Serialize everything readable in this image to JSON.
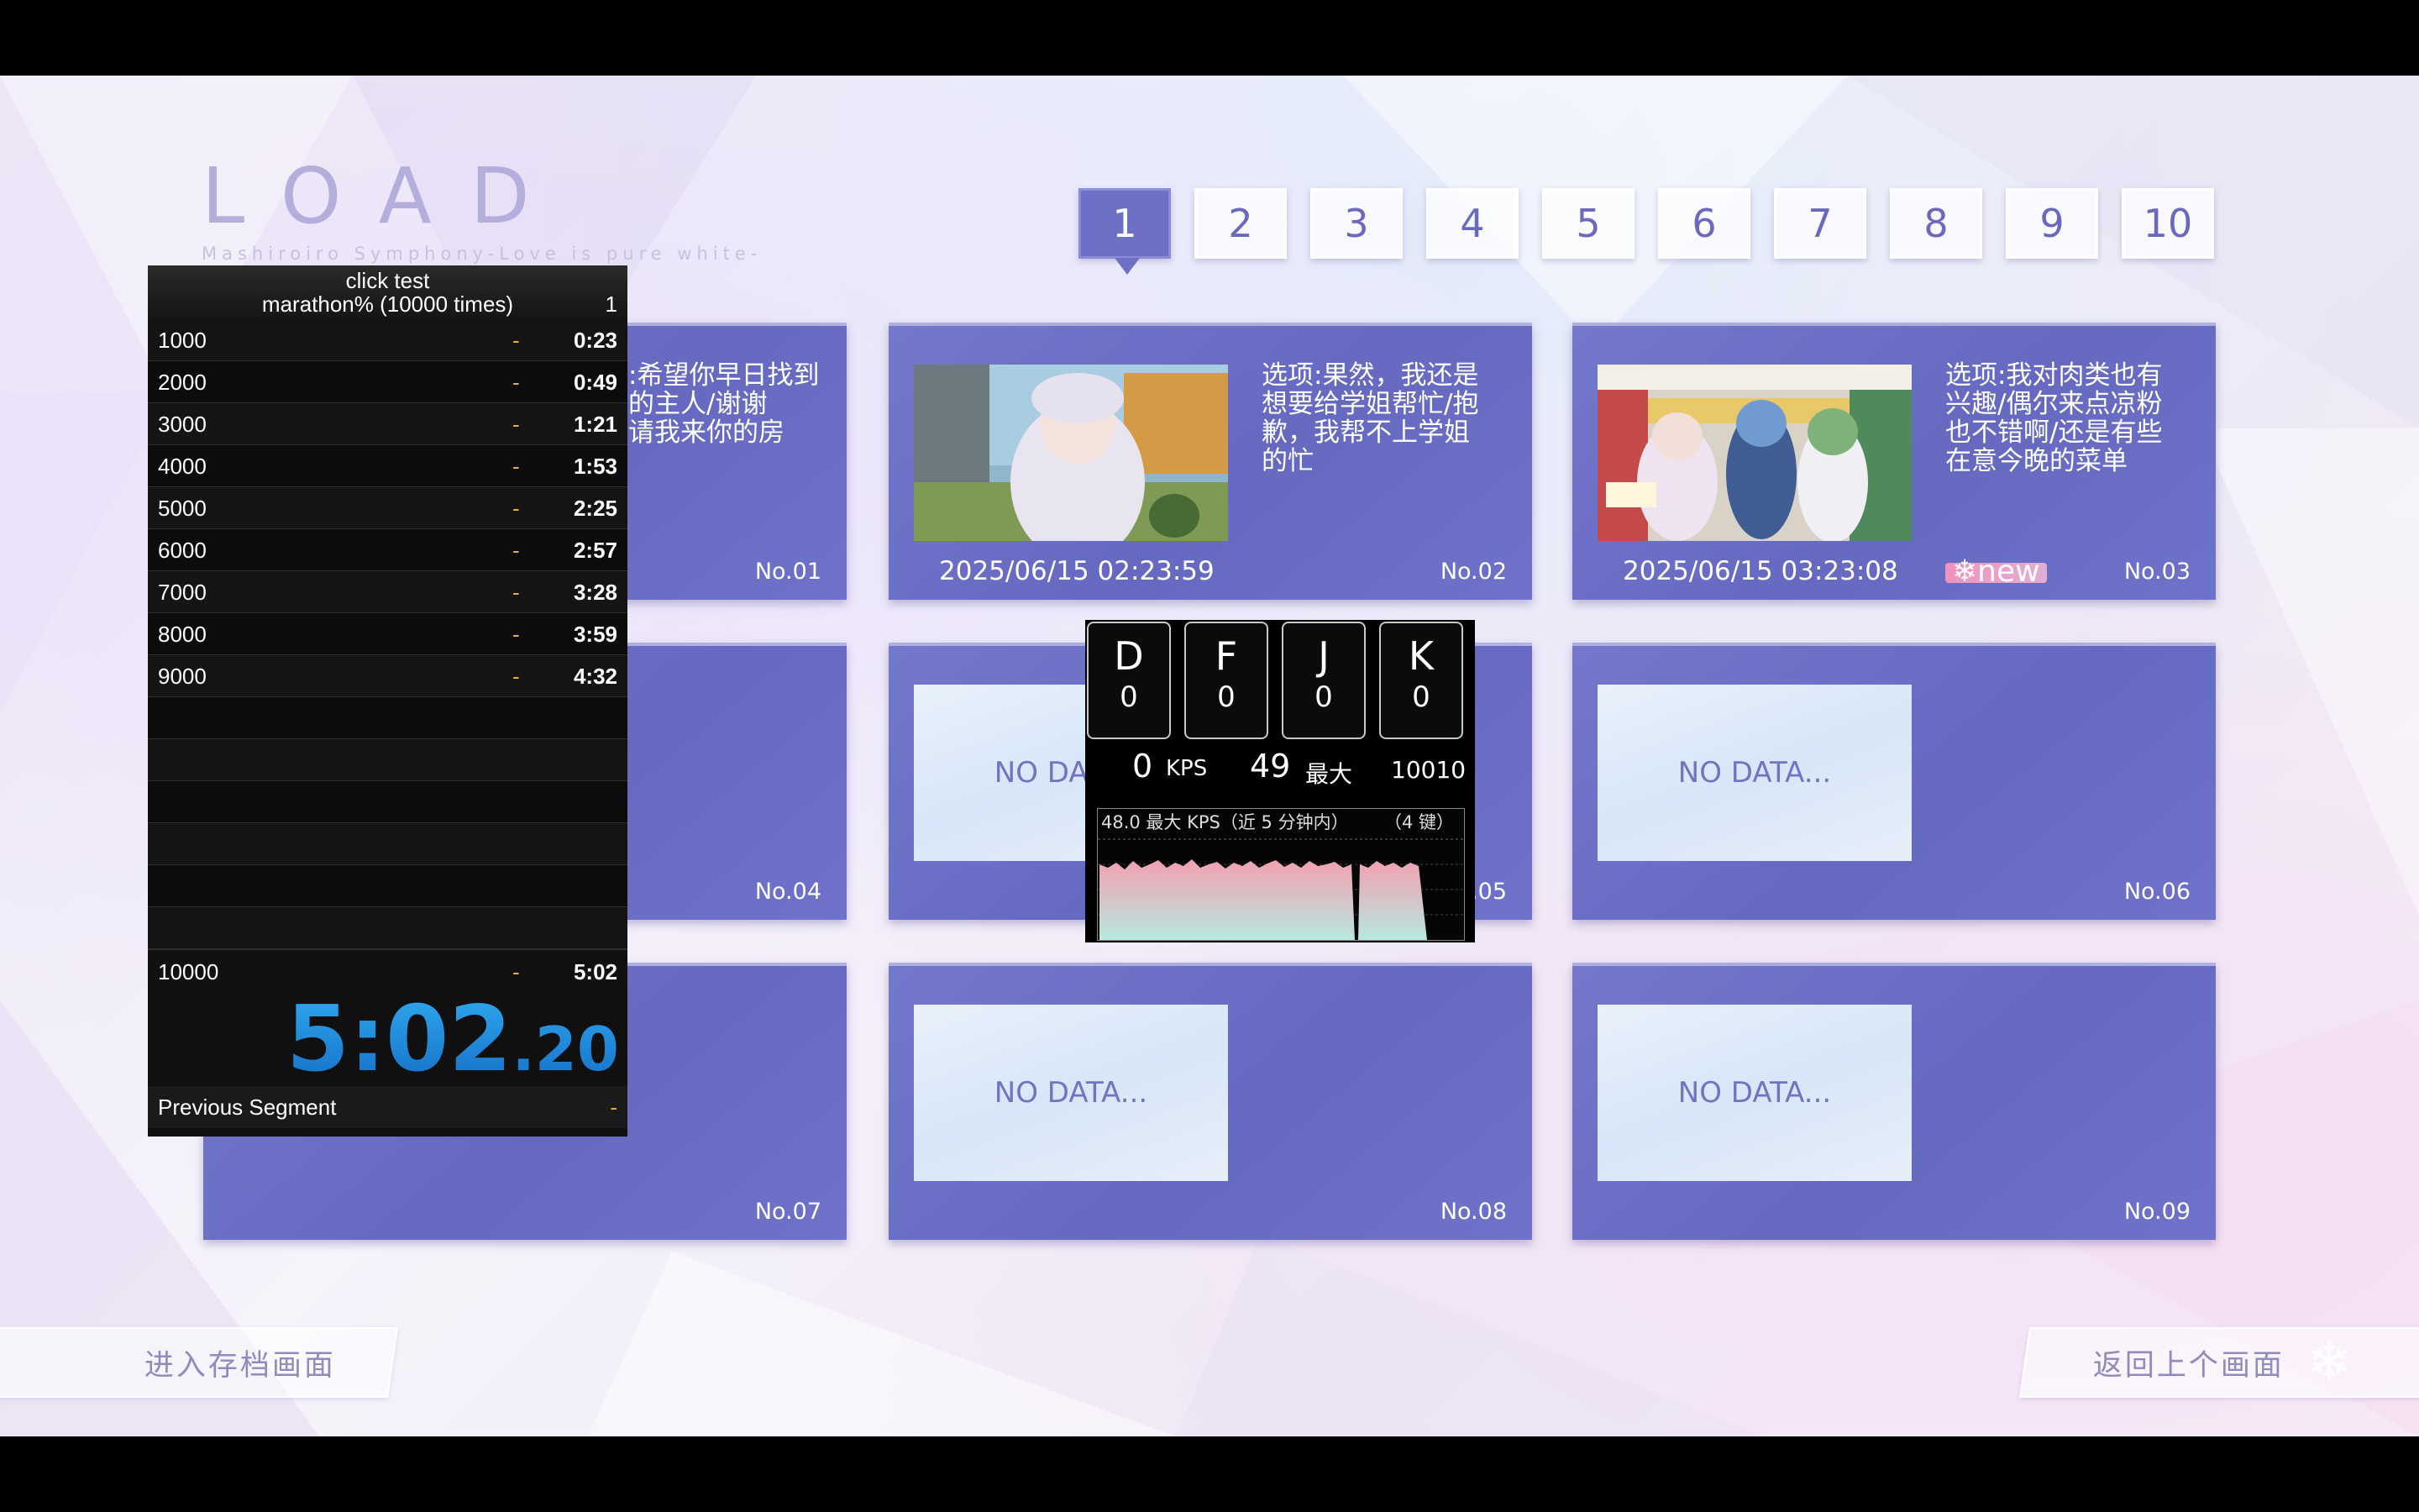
{
  "header": {
    "title": "LOAD",
    "subtitle": "Mashiroiro Symphony-Love is pure white-"
  },
  "pages": {
    "tabs": [
      "1",
      "2",
      "3",
      "4",
      "5",
      "6",
      "7",
      "8",
      "9",
      "10"
    ],
    "active": "1"
  },
  "slots": [
    {
      "no": "No.01",
      "text": "选项:希望你早日找到\n心仪的主人/谢谢\n你邀请我来你的房"
    },
    {
      "no": "No.02",
      "date": "2025/06/15 02:23:59",
      "text": "选项:果然，我还是\n想要给学姐帮忙/抱\n歉，我帮不上学姐\n的忙"
    },
    {
      "no": "No.03",
      "date": "2025/06/15 03:23:08",
      "text": "选项:我对肉类也有\n兴趣/偶尔来点凉粉\n也不错啊/还是有些\n在意今晚的菜单",
      "badge": "new"
    },
    {
      "no": "No.04"
    },
    {
      "no": "No.05",
      "empty": "NO DATA..."
    },
    {
      "no": "No.06",
      "empty": "NO DATA..."
    },
    {
      "no": "No.07"
    },
    {
      "no": "No.08",
      "empty": "NO DATA..."
    },
    {
      "no": "No.09",
      "empty": "NO DATA..."
    }
  ],
  "buttons": {
    "enter_save": "进入存档画面",
    "back": "返回上个画面"
  },
  "timer": {
    "title": "click test",
    "category": "marathon% (10000 times)",
    "attempts": "1",
    "splits": [
      {
        "name": "1000",
        "delta": "-",
        "time": "0:23"
      },
      {
        "name": "2000",
        "delta": "-",
        "time": "0:49"
      },
      {
        "name": "3000",
        "delta": "-",
        "time": "1:21"
      },
      {
        "name": "4000",
        "delta": "-",
        "time": "1:53"
      },
      {
        "name": "5000",
        "delta": "-",
        "time": "2:25"
      },
      {
        "name": "6000",
        "delta": "-",
        "time": "2:57"
      },
      {
        "name": "7000",
        "delta": "-",
        "time": "3:28"
      },
      {
        "name": "8000",
        "delta": "-",
        "time": "3:59"
      },
      {
        "name": "9000",
        "delta": "-",
        "time": "4:32"
      }
    ],
    "final": {
      "name": "10000",
      "delta": "-",
      "time": "5:02"
    },
    "main_time": "5:02",
    "main_fraction": ".20",
    "previous_segment_label": "Previous Segment",
    "previous_segment_value": "-"
  },
  "keyoverlay": {
    "keys": [
      {
        "label": "D",
        "count": "0"
      },
      {
        "label": "F",
        "count": "0"
      },
      {
        "label": "J",
        "count": "0"
      },
      {
        "label": "K",
        "count": "0"
      }
    ],
    "kps": "0",
    "kps_unit": "KPS",
    "max": "49",
    "max_unit": "最大",
    "total": "10010",
    "graph_caption": "48.0 最大 KPS（近 5 分钟内）",
    "graph_keys": "（4 键）"
  },
  "colors": {
    "slot": "#6a6ec4",
    "accent": "#6e70c4",
    "timer_blue": "#2ea7ee",
    "delta_gold": "#e3b140",
    "graph_fill": "#f0a0b0"
  }
}
